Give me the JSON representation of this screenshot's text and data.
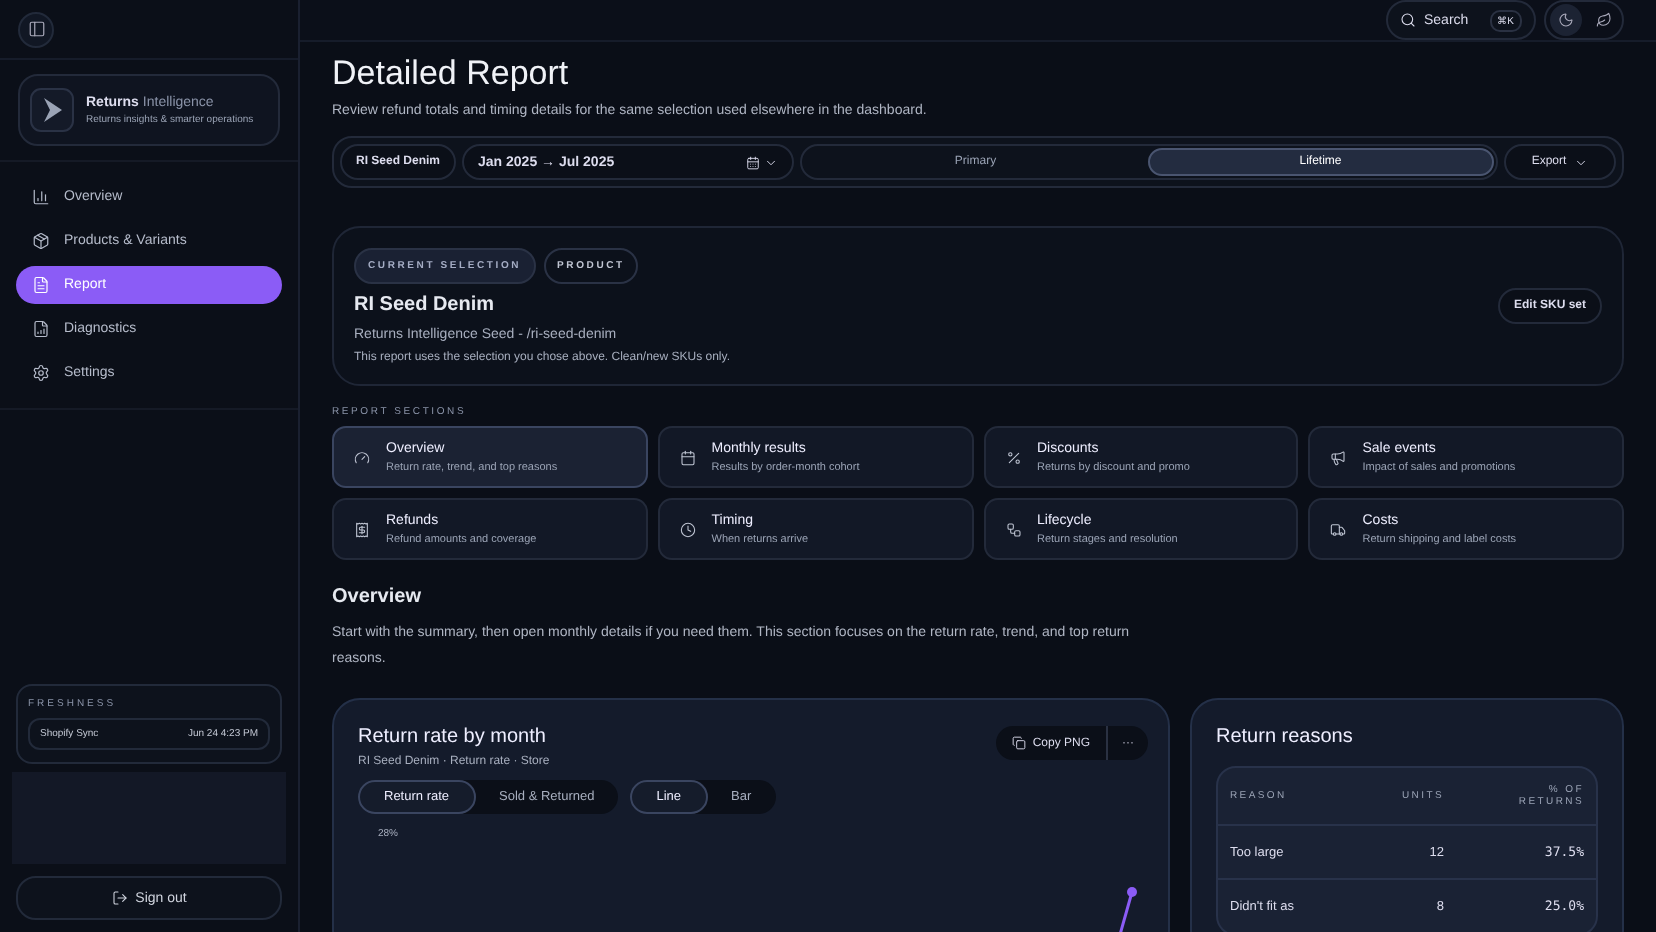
{
  "brand": {
    "name": "Returns",
    "name_accent": "Intelligence",
    "tagline": "Returns insights & smarter operations"
  },
  "nav": [
    {
      "label": "Overview",
      "selected": false
    },
    {
      "label": "Products & Variants",
      "selected": false
    },
    {
      "label": "Report",
      "selected": true
    },
    {
      "label": "Diagnostics",
      "selected": false
    },
    {
      "label": "Settings",
      "selected": false
    }
  ],
  "freshness": {
    "title": "FRESHNESS",
    "source": "Shopify Sync",
    "time": "Jun 24 4:23 PM"
  },
  "sign_out": "Sign out",
  "topbar": {
    "search": "Search",
    "shortcut": "⌘K",
    "theme_modes": [
      {
        "selected": true
      },
      {
        "selected": false
      }
    ]
  },
  "page": {
    "title": "Detailed Report",
    "subtitle": "Review refund totals and timing details for the same selection used elsewhere in the dashboard."
  },
  "filters": {
    "product": "RI Seed Denim",
    "date_range": "Jan 2025 → Jul 2025",
    "views": [
      {
        "label": "Primary",
        "selected": false
      },
      {
        "label": "Lifetime",
        "selected": true
      }
    ],
    "export": "Export"
  },
  "selection": {
    "tags": [
      {
        "label": "CURRENT SELECTION",
        "selected": true
      },
      {
        "label": "PRODUCT",
        "selected": false
      }
    ],
    "name": "RI Seed Denim",
    "source": "Returns Intelligence Seed - /ri-seed-denim",
    "note": "This report uses the selection you chose above. Clean/new SKUs only.",
    "edit": "Edit SKU set"
  },
  "sections_title": "REPORT SECTIONS",
  "sections": [
    {
      "title": "Overview",
      "desc": "Return rate, trend, and top reasons",
      "selected": true
    },
    {
      "title": "Monthly results",
      "desc": "Results by order-month cohort",
      "selected": false
    },
    {
      "title": "Discounts",
      "desc": "Returns by discount and promo",
      "selected": false
    },
    {
      "title": "Sale events",
      "desc": "Impact of sales and promotions",
      "selected": false
    },
    {
      "title": "Refunds",
      "desc": "Refund amounts and coverage",
      "selected": false
    },
    {
      "title": "Timing",
      "desc": "When returns arrive",
      "selected": false
    },
    {
      "title": "Lifecycle",
      "desc": "Return stages and resolution",
      "selected": false
    },
    {
      "title": "Costs",
      "desc": "Return shipping and label costs",
      "selected": false
    }
  ],
  "overview": {
    "title": "Overview",
    "text": "Start with the summary, then open monthly details if you need them. This section focuses on the return rate, trend, and top return reasons."
  },
  "chart_card": {
    "title": "Return rate by month",
    "subtitle": "RI Seed Denim · Return rate · Store",
    "copy": "Copy PNG",
    "more": "···",
    "metrics": [
      {
        "label": "Return rate",
        "selected": true
      },
      {
        "label": "Sold & Returned",
        "selected": false
      }
    ],
    "types": [
      {
        "label": "Line",
        "selected": true
      },
      {
        "label": "Bar",
        "selected": false
      }
    ],
    "y_label": "28%"
  },
  "reasons": {
    "title": "Return reasons",
    "columns": [
      "REASON",
      "UNITS",
      "% OF RETURNS"
    ],
    "rows": [
      {
        "reason": "Too large",
        "units": "12",
        "share": "37.5%"
      },
      {
        "reason": "Didn't fit as",
        "units": "8",
        "share": "25.0%"
      }
    ]
  }
}
